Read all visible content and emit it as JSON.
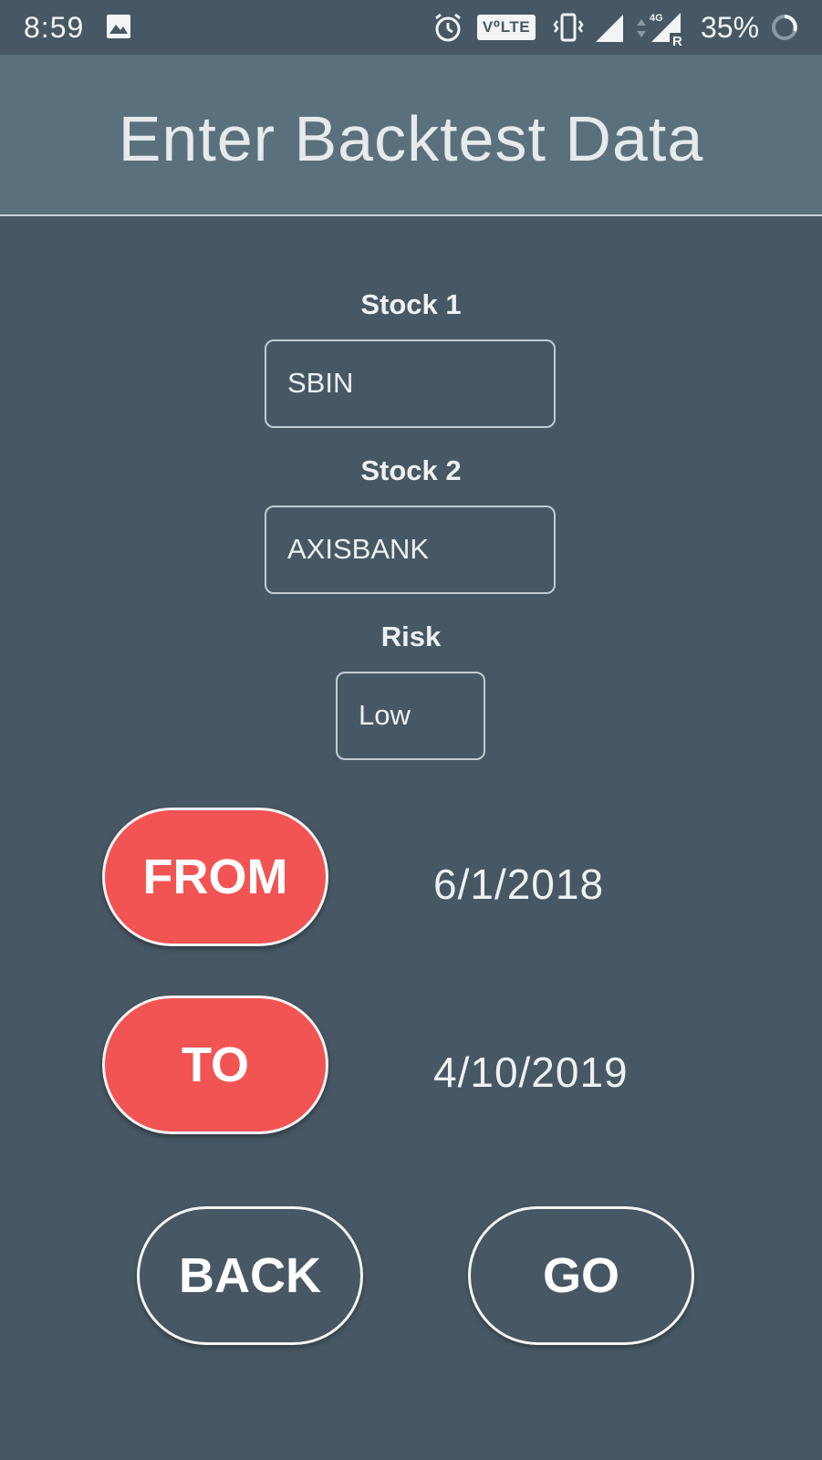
{
  "status_bar": {
    "time": "8:59",
    "volte": "V⁰LTE",
    "network": "4G",
    "roaming": "R",
    "battery_percent": "35%",
    "icons": [
      "gallery-icon",
      "alarm-icon",
      "vibrate-icon",
      "signal-icon",
      "data-arrows-icon",
      "signal-roaming-icon",
      "battery-circle-icon"
    ]
  },
  "app_bar": {
    "title": "Enter Backtest Data"
  },
  "form": {
    "stock1": {
      "label": "Stock 1",
      "value": "SBIN"
    },
    "stock2": {
      "label": "Stock 2",
      "value": "AXISBANK"
    },
    "risk": {
      "label": "Risk",
      "value": "Low"
    }
  },
  "dates": {
    "from_label": "FROM",
    "from_value": "6/1/2018",
    "to_label": "TO",
    "to_value": "4/10/2019"
  },
  "actions": {
    "back_label": "BACK",
    "go_label": "GO"
  },
  "colors": {
    "background": "#475864",
    "app_bar": "#5a707c",
    "accent_red": "#f25454"
  }
}
